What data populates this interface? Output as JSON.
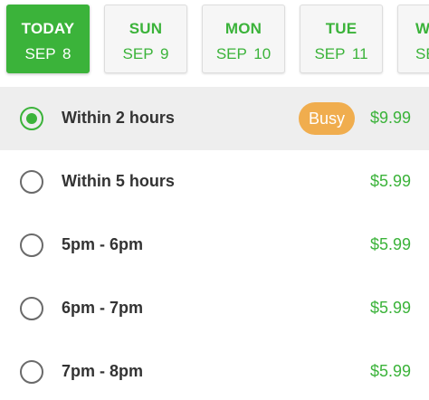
{
  "dates": [
    {
      "day": "TODAY",
      "date": "SEP 8",
      "selected": true
    },
    {
      "day": "SUN",
      "date": "SEP 9",
      "selected": false
    },
    {
      "day": "MON",
      "date": "SEP 10",
      "selected": false
    },
    {
      "day": "TUE",
      "date": "SEP 11",
      "selected": false
    },
    {
      "day": "W",
      "date": "SE",
      "selected": false
    }
  ],
  "slots": [
    {
      "label": "Within 2 hours",
      "price": "$9.99",
      "badge": "Busy",
      "selected": true
    },
    {
      "label": "Within 5 hours",
      "price": "$5.99",
      "badge": "",
      "selected": false
    },
    {
      "label": "5pm - 6pm",
      "price": "$5.99",
      "badge": "",
      "selected": false
    },
    {
      "label": "6pm - 7pm",
      "price": "$5.99",
      "badge": "",
      "selected": false
    },
    {
      "label": "7pm - 8pm",
      "price": "$5.99",
      "badge": "",
      "selected": false
    }
  ],
  "colors": {
    "accent": "#3bb33a",
    "busy": "#f0ad4e",
    "selected_row": "#eeeeee"
  }
}
